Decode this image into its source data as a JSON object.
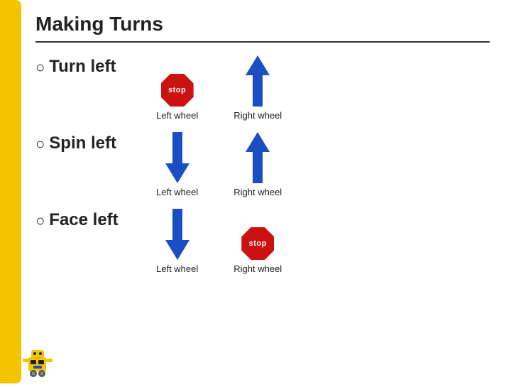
{
  "page": {
    "title": "Making Turns",
    "left_bar_color": "#f5c400",
    "divider_color": "#333"
  },
  "rows": [
    {
      "id": "turn-left",
      "bullet": "○",
      "label": "Turn left",
      "left_wheel": {
        "type": "stop",
        "label": "Left wheel",
        "stop_text": "stop"
      },
      "right_wheel": {
        "type": "arrow-up",
        "label": "Right wheel"
      }
    },
    {
      "id": "spin-left",
      "bullet": "○",
      "label": "Spin left",
      "left_wheel": {
        "type": "arrow-down",
        "label": "Left wheel"
      },
      "right_wheel": {
        "type": "arrow-up",
        "label": "Right wheel"
      }
    },
    {
      "id": "face-left",
      "bullet": "○",
      "label": "Face left",
      "left_wheel": {
        "type": "arrow-down",
        "label": "Left wheel"
      },
      "right_wheel": {
        "type": "stop",
        "label": "Right wheel",
        "stop_text": "stop"
      }
    }
  ],
  "colors": {
    "arrow_blue": "#1a4fc4",
    "stop_red": "#cc1111",
    "stop_text": "stop",
    "text": "#222"
  }
}
